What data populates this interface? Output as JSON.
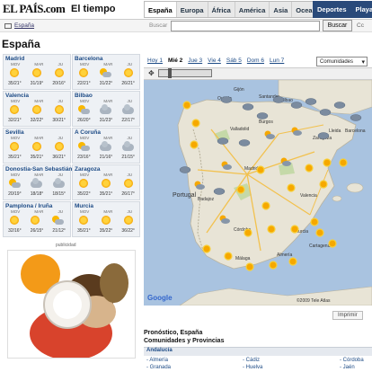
{
  "header": {
    "logo": "EL PAÍS.com",
    "section": "El tiempo",
    "nav": [
      "España",
      "Europa",
      "África",
      "América",
      "Asia",
      "Oceanía"
    ],
    "nav_active": "España",
    "nav_right": [
      "Deportes",
      "Playas"
    ]
  },
  "toolbar": {
    "breadcrumb": "España",
    "search_label": "Buscar",
    "search_value": "",
    "search_button": "Buscar",
    "search_extra": "Cc"
  },
  "page_title": "España",
  "cities": [
    {
      "name": "Madrid",
      "days": [
        "MOV",
        "MAR",
        "JU"
      ],
      "icons": [
        "sun",
        "sun",
        "sun"
      ],
      "temps": [
        "35/21°",
        "31/19°",
        "20/16°"
      ]
    },
    {
      "name": "Barcelona",
      "days": [
        "MOV",
        "MAR",
        "JU"
      ],
      "icons": [
        "sun",
        "suncloud",
        "sun"
      ],
      "temps": [
        "22/21°",
        "31/22°",
        "26/21°"
      ]
    },
    {
      "name": "Valencia",
      "days": [
        "MOV",
        "MAR",
        "JU"
      ],
      "icons": [
        "sun",
        "sun",
        "sun"
      ],
      "temps": [
        "32/21°",
        "32/22°",
        "30/21°"
      ]
    },
    {
      "name": "Bilbao",
      "days": [
        "MOV",
        "MAR",
        "JU"
      ],
      "icons": [
        "suncloud",
        "cloud",
        "cloud"
      ],
      "temps": [
        "26/20°",
        "31/23°",
        "22/17°"
      ]
    },
    {
      "name": "Sevilla",
      "days": [
        "MOV",
        "MAR",
        "JU"
      ],
      "icons": [
        "sun",
        "sun",
        "sun"
      ],
      "temps": [
        "35/21°",
        "35/21°",
        "36/21°"
      ]
    },
    {
      "name": "A Coruña",
      "days": [
        "MOV",
        "MAR",
        "JU"
      ],
      "icons": [
        "suncloud",
        "cloud",
        "cloud"
      ],
      "temps": [
        "23/16°",
        "21/16°",
        "21/15°"
      ]
    },
    {
      "name": "Donostia-San Sebastián",
      "days": [
        "MOV",
        "MAR",
        "JU"
      ],
      "icons": [
        "suncloud",
        "cloud",
        "cloud"
      ],
      "temps": [
        "20/19°",
        "18/18°",
        "18/15°"
      ]
    },
    {
      "name": "Zaragoza",
      "days": [
        "MOV",
        "MAR",
        "JU"
      ],
      "icons": [
        "sun",
        "sun",
        "sun"
      ],
      "temps": [
        "35/22°",
        "35/21°",
        "26/17°"
      ]
    },
    {
      "name": "Pamplona / Iruña",
      "days": [
        "MOV",
        "MAR",
        "JU"
      ],
      "icons": [
        "sun",
        "sun",
        "suncloud"
      ],
      "temps": [
        "32/16°",
        "26/15°",
        "21/12°"
      ]
    },
    {
      "name": "Murcia",
      "days": [
        "MOV",
        "MAR",
        "JU"
      ],
      "icons": [
        "sun",
        "sun",
        "sun"
      ],
      "temps": [
        "35/21°",
        "35/22°",
        "36/22°"
      ]
    }
  ],
  "ad_label": "publicidad",
  "map": {
    "tabs": [
      "Hoy 1",
      "Mié 2",
      "Jue 3",
      "Vie 4",
      "Sáb 5",
      "Dom 6",
      "Lun 7"
    ],
    "tab_selected": "Mié 2",
    "selector": "Comunidades",
    "labels": [
      "Gijón",
      "Oviedo",
      "Santander",
      "Bilbao",
      "Burgos",
      "Valladolid",
      "Zaragoza",
      "Lleida",
      "Barcelona",
      "Portugal",
      "Madrid",
      "Valencia",
      "Córdoba",
      "Málaga",
      "Almería",
      "Murcia",
      "Cartagena",
      "Badajoz"
    ],
    "google": "Google",
    "copyright": "©2009 Tele Atlas"
  },
  "print_label": "Imprimir",
  "forecast": {
    "title_line1": "Pronóstico, España",
    "title_line2": "Comunidades y Provincias",
    "region": "Andalucía",
    "col1": [
      "- Almería",
      "- Granada"
    ],
    "col2": [
      "- Cádiz",
      "- Huelva"
    ],
    "col3": [
      "- Córdoba",
      "- Jaén"
    ]
  },
  "colors": {
    "sea": "#a9c3e0",
    "land": "#e8e4d6",
    "city_bg": "#eef1f5",
    "link": "#1d4b86",
    "sun": "#f9b800",
    "header_blue": "#2a4a7a"
  }
}
